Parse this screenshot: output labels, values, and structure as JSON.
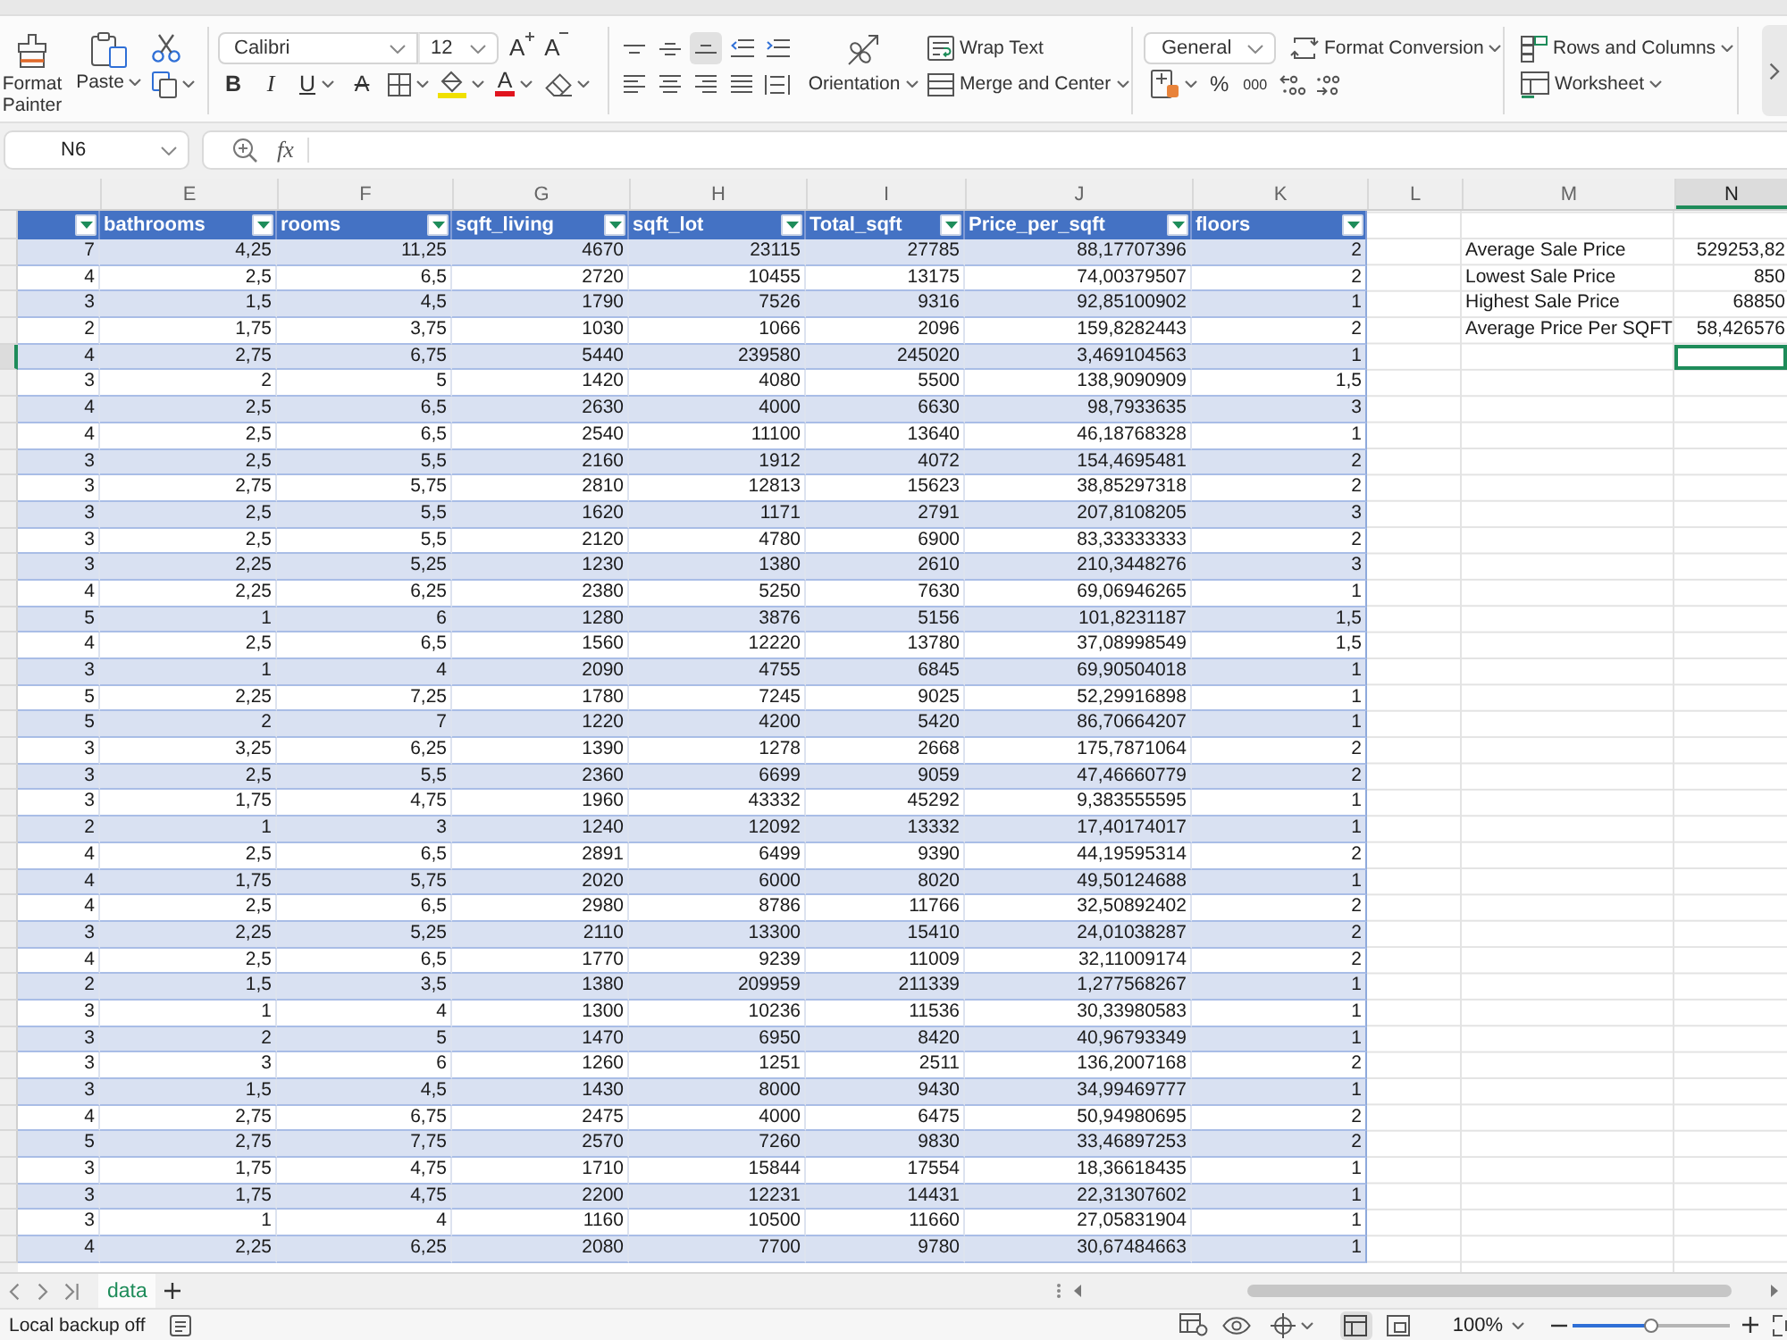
{
  "ribbon": {
    "format_painter": "Format Painter",
    "paste": "Paste",
    "font_name": "Calibri",
    "font_size": "12",
    "size_buttons": [
      {
        "kind": "grow",
        "glyph": "A"
      },
      {
        "kind": "shrink",
        "glyph": "A"
      }
    ],
    "style_buttons": [
      {
        "kind": "bold",
        "glyph": "B"
      },
      {
        "kind": "italic",
        "glyph": "I"
      },
      {
        "kind": "underline",
        "glyph": "U"
      },
      {
        "kind": "strikethrough",
        "glyph": "A"
      }
    ],
    "font_color_glyph": "A",
    "vertical_align": [
      {
        "kind": "top",
        "selected": false
      },
      {
        "kind": "middle",
        "selected": false
      },
      {
        "kind": "bottom",
        "selected": true
      }
    ],
    "orientation": "Orientation",
    "wrap_text": "Wrap Text",
    "merge": "Merge and Center",
    "number_format": "General",
    "format_conversion": "Format Conversion",
    "number_buttons": [
      {
        "kind": "percent",
        "glyph": "%"
      },
      {
        "kind": "thousands",
        "glyph": "000"
      }
    ],
    "rows_and_columns": "Rows and Columns",
    "worksheet": "Worksheet"
  },
  "formula_bar": {
    "name_box": "N6",
    "function_label": "fx"
  },
  "column_bar": [
    {
      "letter": "E",
      "selected": false
    },
    {
      "letter": "F",
      "selected": false
    },
    {
      "letter": "G",
      "selected": false
    },
    {
      "letter": "H",
      "selected": false
    },
    {
      "letter": "I",
      "selected": false
    },
    {
      "letter": "J",
      "selected": false
    },
    {
      "letter": "K",
      "selected": false
    },
    {
      "letter": "L",
      "selected": false
    },
    {
      "letter": "M",
      "selected": false
    },
    {
      "letter": "N",
      "selected": true
    }
  ],
  "table": {
    "headers": [
      "bathrooms",
      "rooms",
      "sqft_living",
      "sqft_lot",
      "Total_sqft",
      "Price_per_sqft",
      "floors"
    ],
    "rows": [
      {
        "cells": [
          "7",
          "4,25",
          "11,25",
          "4670",
          "23115",
          "27785",
          "88,17707396",
          "2"
        ],
        "selected": false
      },
      {
        "cells": [
          "4",
          "2,5",
          "6,5",
          "2720",
          "10455",
          "13175",
          "74,00379507",
          "2"
        ],
        "selected": false
      },
      {
        "cells": [
          "3",
          "1,5",
          "4,5",
          "1790",
          "7526",
          "9316",
          "92,85100902",
          "1"
        ],
        "selected": false
      },
      {
        "cells": [
          "2",
          "1,75",
          "3,75",
          "1030",
          "1066",
          "2096",
          "159,8282443",
          "2"
        ],
        "selected": false
      },
      {
        "cells": [
          "4",
          "2,75",
          "6,75",
          "5440",
          "239580",
          "245020",
          "3,469104563",
          "1"
        ],
        "selected": true
      },
      {
        "cells": [
          "3",
          "2",
          "5",
          "1420",
          "4080",
          "5500",
          "138,9090909",
          "1,5"
        ],
        "selected": false
      },
      {
        "cells": [
          "4",
          "2,5",
          "6,5",
          "2630",
          "4000",
          "6630",
          "98,7933635",
          "3"
        ],
        "selected": false
      },
      {
        "cells": [
          "4",
          "2,5",
          "6,5",
          "2540",
          "11100",
          "13640",
          "46,18768328",
          "1"
        ],
        "selected": false
      },
      {
        "cells": [
          "3",
          "2,5",
          "5,5",
          "2160",
          "1912",
          "4072",
          "154,4695481",
          "2"
        ],
        "selected": false
      },
      {
        "cells": [
          "3",
          "2,75",
          "5,75",
          "2810",
          "12813",
          "15623",
          "38,85297318",
          "2"
        ],
        "selected": false
      },
      {
        "cells": [
          "3",
          "2,5",
          "5,5",
          "1620",
          "1171",
          "2791",
          "207,8108205",
          "3"
        ],
        "selected": false
      },
      {
        "cells": [
          "3",
          "2,5",
          "5,5",
          "2120",
          "4780",
          "6900",
          "83,33333333",
          "2"
        ],
        "selected": false
      },
      {
        "cells": [
          "3",
          "2,25",
          "5,25",
          "1230",
          "1380",
          "2610",
          "210,3448276",
          "3"
        ],
        "selected": false
      },
      {
        "cells": [
          "4",
          "2,25",
          "6,25",
          "2380",
          "5250",
          "7630",
          "69,06946265",
          "1"
        ],
        "selected": false
      },
      {
        "cells": [
          "5",
          "1",
          "6",
          "1280",
          "3876",
          "5156",
          "101,8231187",
          "1,5"
        ],
        "selected": false
      },
      {
        "cells": [
          "4",
          "2,5",
          "6,5",
          "1560",
          "12220",
          "13780",
          "37,08998549",
          "1,5"
        ],
        "selected": false
      },
      {
        "cells": [
          "3",
          "1",
          "4",
          "2090",
          "4755",
          "6845",
          "69,90504018",
          "1"
        ],
        "selected": false
      },
      {
        "cells": [
          "5",
          "2,25",
          "7,25",
          "1780",
          "7245",
          "9025",
          "52,29916898",
          "1"
        ],
        "selected": false
      },
      {
        "cells": [
          "5",
          "2",
          "7",
          "1220",
          "4200",
          "5420",
          "86,70664207",
          "1"
        ],
        "selected": false
      },
      {
        "cells": [
          "3",
          "3,25",
          "6,25",
          "1390",
          "1278",
          "2668",
          "175,7871064",
          "2"
        ],
        "selected": false
      },
      {
        "cells": [
          "3",
          "2,5",
          "5,5",
          "2360",
          "6699",
          "9059",
          "47,46660779",
          "2"
        ],
        "selected": false
      },
      {
        "cells": [
          "3",
          "1,75",
          "4,75",
          "1960",
          "43332",
          "45292",
          "9,383555595",
          "1"
        ],
        "selected": false
      },
      {
        "cells": [
          "2",
          "1",
          "3",
          "1240",
          "12092",
          "13332",
          "17,40174017",
          "1"
        ],
        "selected": false
      },
      {
        "cells": [
          "4",
          "2,5",
          "6,5",
          "2891",
          "6499",
          "9390",
          "44,19595314",
          "2"
        ],
        "selected": false
      },
      {
        "cells": [
          "4",
          "1,75",
          "5,75",
          "2020",
          "6000",
          "8020",
          "49,50124688",
          "1"
        ],
        "selected": false
      },
      {
        "cells": [
          "4",
          "2,5",
          "6,5",
          "2980",
          "8786",
          "11766",
          "32,50892402",
          "2"
        ],
        "selected": false
      },
      {
        "cells": [
          "3",
          "2,25",
          "5,25",
          "2110",
          "13300",
          "15410",
          "24,01038287",
          "2"
        ],
        "selected": false
      },
      {
        "cells": [
          "4",
          "2,5",
          "6,5",
          "1770",
          "9239",
          "11009",
          "32,11009174",
          "2"
        ],
        "selected": false
      },
      {
        "cells": [
          "2",
          "1,5",
          "3,5",
          "1380",
          "209959",
          "211339",
          "1,277568267",
          "1"
        ],
        "selected": false
      },
      {
        "cells": [
          "3",
          "1",
          "4",
          "1300",
          "10236",
          "11536",
          "30,33980583",
          "1"
        ],
        "selected": false
      },
      {
        "cells": [
          "3",
          "2",
          "5",
          "1470",
          "6950",
          "8420",
          "40,96793349",
          "1"
        ],
        "selected": false
      },
      {
        "cells": [
          "3",
          "3",
          "6",
          "1260",
          "1251",
          "2511",
          "136,2007168",
          "2"
        ],
        "selected": false
      },
      {
        "cells": [
          "3",
          "1,5",
          "4,5",
          "1430",
          "8000",
          "9430",
          "34,99469777",
          "1"
        ],
        "selected": false
      },
      {
        "cells": [
          "4",
          "2,75",
          "6,75",
          "2475",
          "4000",
          "6475",
          "50,94980695",
          "2"
        ],
        "selected": false
      },
      {
        "cells": [
          "5",
          "2,75",
          "7,75",
          "2570",
          "7260",
          "9830",
          "33,46897253",
          "2"
        ],
        "selected": false
      },
      {
        "cells": [
          "3",
          "1,75",
          "4,75",
          "1710",
          "15844",
          "17554",
          "18,36618435",
          "1"
        ],
        "selected": false
      },
      {
        "cells": [
          "3",
          "1,75",
          "4,75",
          "2200",
          "12231",
          "14431",
          "22,31307602",
          "1"
        ],
        "selected": false
      },
      {
        "cells": [
          "3",
          "1",
          "4",
          "1160",
          "10500",
          "11660",
          "27,05831904",
          "1"
        ],
        "selected": false
      },
      {
        "cells": [
          "4",
          "2,25",
          "6,25",
          "2080",
          "7700",
          "9780",
          "30,67484663",
          "1"
        ],
        "selected": false
      }
    ],
    "summary": [
      {
        "label": "Average Sale Price",
        "value": "529253,82"
      },
      {
        "label": "Lowest Sale Price",
        "value": "850"
      },
      {
        "label": "Highest Sale Price",
        "value": "68850"
      },
      {
        "label": "Average Price Per SQFT",
        "value": "58,426576"
      }
    ]
  },
  "sheet_tabs": [
    {
      "name": "data",
      "selected": true
    }
  ],
  "status_bar": {
    "backup": "Local backup off",
    "views": [
      {
        "kind": "normal",
        "selected": true
      },
      {
        "kind": "page",
        "selected": false
      }
    ],
    "zoom": {
      "label": "100%",
      "level": 0.5
    }
  }
}
